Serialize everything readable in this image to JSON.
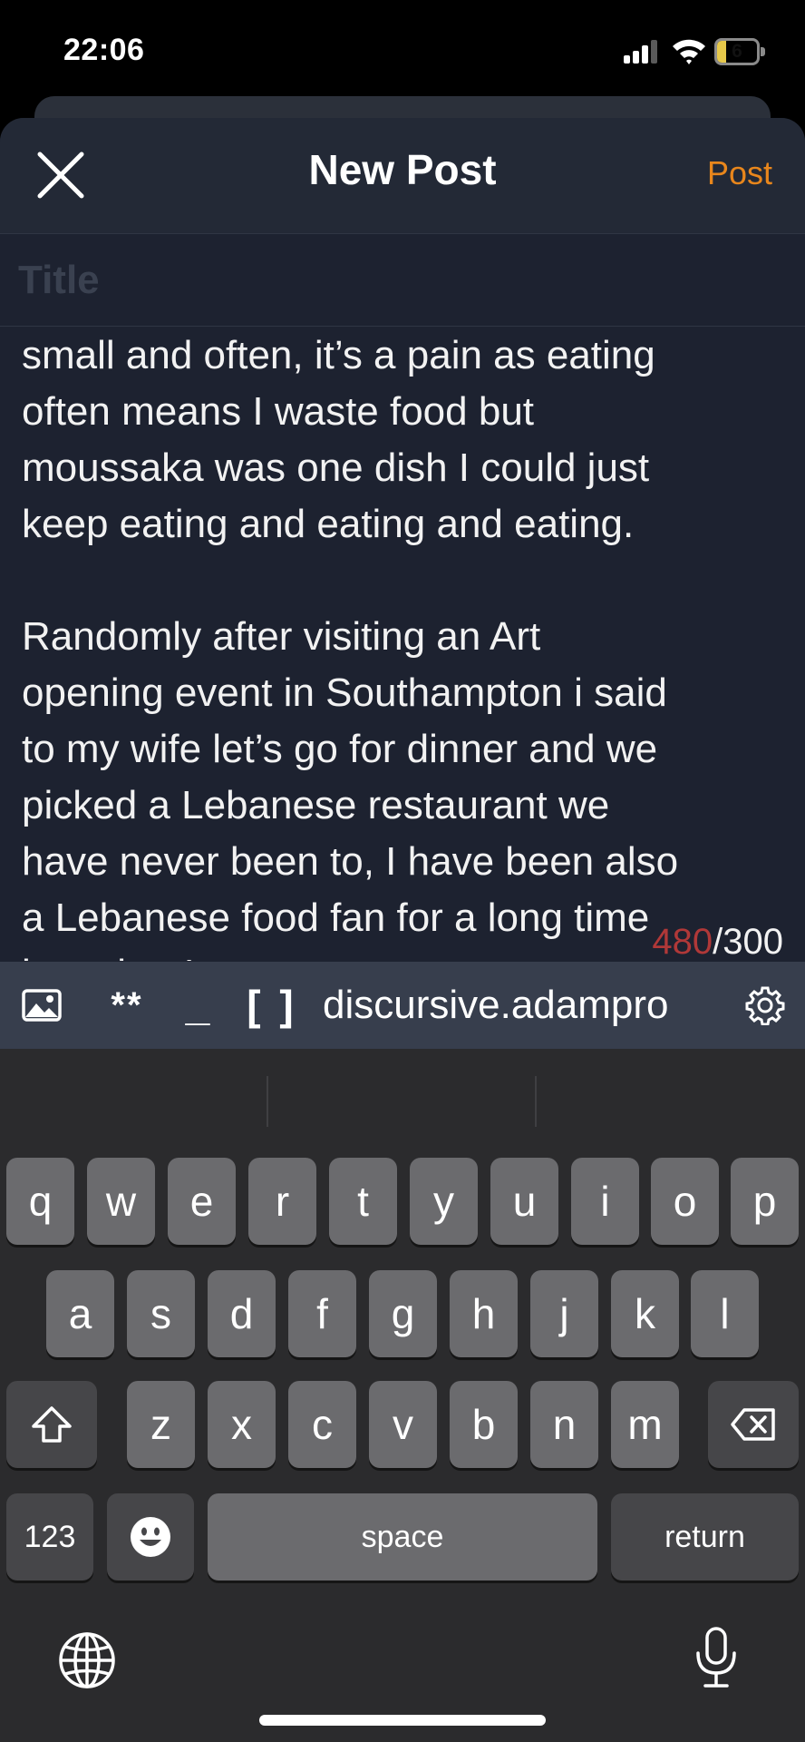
{
  "status_bar": {
    "time": "22:06",
    "battery_level": "6",
    "icons": [
      "cellular-signal-icon",
      "wifi-icon",
      "battery-icon"
    ]
  },
  "nav": {
    "title": "New Post",
    "post_label": "Post",
    "close_icon": "close-icon",
    "accent_color": "#e8861c"
  },
  "title_field": {
    "placeholder": "Title",
    "value": ""
  },
  "body": {
    "text": "I loved moussaka, I tend to eat\nsmall and often, it’s a pain as eating\noften means I waste food but\nmoussaka was one dish I could just\nkeep eating and eating and eating.\n\nRandomly after visiting an Art\nopening event in Southampton i said\nto my wife let’s go for dinner and we\npicked a Lebanese restaurant we\nhave never been to, I have been also\na Lebanese food fan for a long time\nbut what I..."
  },
  "counter": {
    "current": "480",
    "limit": "/300",
    "over_color": "#b03838"
  },
  "toolbar": {
    "bold_label": "**",
    "underline_label": "_",
    "link_label": "[ ]",
    "domain_label": "discursive.adampro",
    "icons": [
      "image-icon",
      "gear-icon"
    ]
  },
  "keyboard": {
    "row1": [
      "q",
      "w",
      "e",
      "r",
      "t",
      "y",
      "u",
      "i",
      "o",
      "p"
    ],
    "row2": [
      "a",
      "s",
      "d",
      "f",
      "g",
      "h",
      "j",
      "k",
      "l"
    ],
    "row3": [
      "z",
      "x",
      "c",
      "v",
      "b",
      "n",
      "m"
    ],
    "numbers_label": "123",
    "space_label": "space",
    "return_label": "return",
    "icons": [
      "shift-icon",
      "backspace-icon",
      "emoji-icon",
      "globe-icon",
      "microphone-icon"
    ]
  }
}
